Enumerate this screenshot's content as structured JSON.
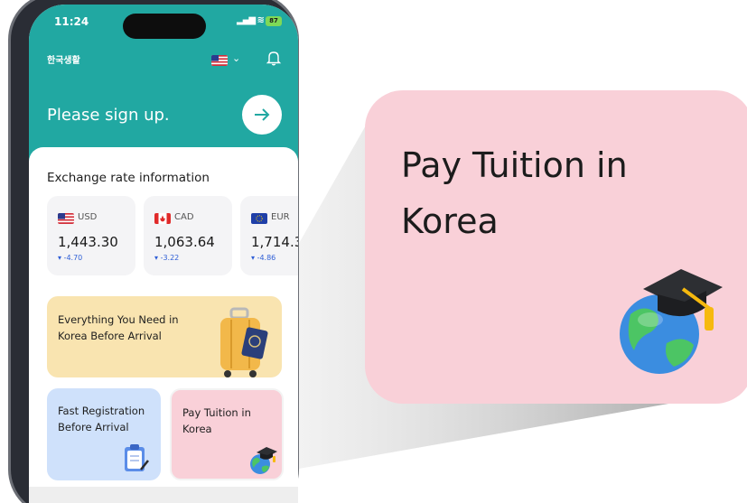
{
  "status_bar": {
    "time": "11:24",
    "battery": "87",
    "signal_icon": "signal-wifi-icon"
  },
  "header": {
    "brand": "한국생활",
    "language_flag_icon": "us-flag-icon",
    "dropdown_icon": "chevron-down-icon",
    "notification_icon": "bell-icon"
  },
  "hero": {
    "signup_text": "Please sign up.",
    "arrow_icon": "arrow-right-icon"
  },
  "exchange": {
    "title": "Exchange rate information",
    "cards": [
      {
        "code": "USD",
        "rate": "1,443.30",
        "change": "-4.70",
        "flag_icon": "us-flag-icon"
      },
      {
        "code": "CAD",
        "rate": "1,063.64",
        "change": "-3.22",
        "flag_icon": "canada-flag-icon"
      },
      {
        "code": "EUR",
        "rate": "1,714.3",
        "change": "-4.86",
        "flag_icon": "eu-flag-icon"
      }
    ]
  },
  "features": {
    "banner": {
      "text": "Everything You Need in Korea Before Arrival",
      "icon": "suitcase-passport-icon"
    },
    "tile_registration": {
      "text": "Fast Registration Before Arrival",
      "icon": "clipboard-icon"
    },
    "tile_tuition": {
      "text": "Pay Tuition in Korea",
      "icon": "globe-graduation-cap-icon"
    }
  },
  "callout": {
    "title": "Pay Tuition in Korea",
    "icon": "globe-graduation-cap-icon"
  },
  "colors": {
    "teal": "#21a8a2",
    "card_bg": "#f4f4f6",
    "banner_yellow": "#f9e4b0",
    "tile_blue": "#cfe1fb",
    "tile_pink": "#f9d0d8",
    "change_down": "#2f5fd6"
  }
}
